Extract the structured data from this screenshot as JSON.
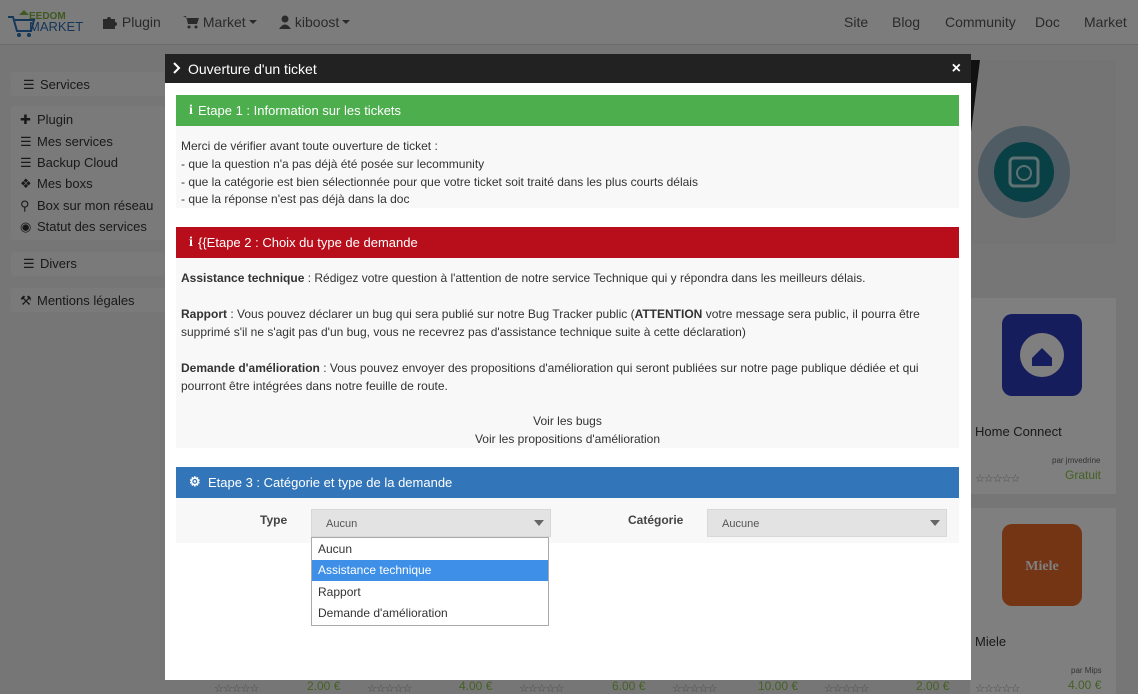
{
  "navbar": {
    "brand": "EEDOM MARKET",
    "plugin": "Plugin",
    "market": "Market",
    "user": "kiboost",
    "links": [
      "Site",
      "Blog",
      "Community",
      "Doc",
      "Market"
    ]
  },
  "sidebar": {
    "services": "Services",
    "items": [
      "Plugin",
      "Mes services",
      "Backup Cloud",
      "Mes boxs",
      "Box sur mon réseau",
      "Statut des services"
    ],
    "divers": "Divers",
    "mentions": "Mentions légales"
  },
  "background": {
    "cards": [
      {
        "name": "Home Connect",
        "author": "par jmvedrine",
        "price": "Gratuit"
      },
      {
        "name": "Miele",
        "author": "par Mips",
        "price": "4.00 €"
      }
    ],
    "bottom_prices": [
      "2.00 €",
      "4.00 €",
      "6.00 €",
      "10.00 €",
      "2.00 €"
    ]
  },
  "modal": {
    "title": "Ouverture d'un ticket",
    "close": "×",
    "step1": {
      "title": "Etape 1 : Information sur les tickets",
      "lines": [
        "Merci de vérifier avant toute ouverture de ticket :",
        "- que la question n'a pas déjà été posée sur le",
        "- que la catégorie est bien sélectionnée pour que votre ticket soit traité dans les plus courts délais",
        "- que la réponse n'est pas déjà dans la "
      ],
      "community_link": "community",
      "doc_link": "doc"
    },
    "step2": {
      "title": "{{Etape 2 : Choix du type de demande",
      "assist_label": "Assistance technique",
      "assist_text": " : Rédigez votre question à l'attention de notre service Technique qui y répondra dans les meilleurs délais.",
      "rapport_label": "Rapport",
      "rapport_text1": " : Vous pouvez déclarer un bug qui sera publié sur notre Bug Tracker public (",
      "rapport_attention": "ATTENTION",
      "rapport_text2": " votre message sera public, il pourra être",
      "rapport_text3": "supprimé s'il ne s'agit pas d'un bug, vous ne recevrez pas d'assistance technique suite à cette déclaration)",
      "amelio_label": "Demande d'amélioration",
      "amelio_text1": " : Vous pouvez envoyer des propositions d'amélioration qui seront publiées sur notre page publique dédiée et qui",
      "amelio_text2": "pourront être intégrées dans notre feuille de route.",
      "link_bugs": "Voir les bugs",
      "link_props": "Voir les propositions d'amélioration"
    },
    "step3": {
      "title": "Etape 3 : Catégorie et type de la demande",
      "type_label": "Type",
      "type_value": "Aucun",
      "cat_label": "Catégorie",
      "cat_value": "Aucune",
      "options": [
        "Aucun",
        "Assistance technique",
        "Rapport",
        "Demande d'amélioration"
      ],
      "selected_option": "Assistance technique"
    }
  }
}
